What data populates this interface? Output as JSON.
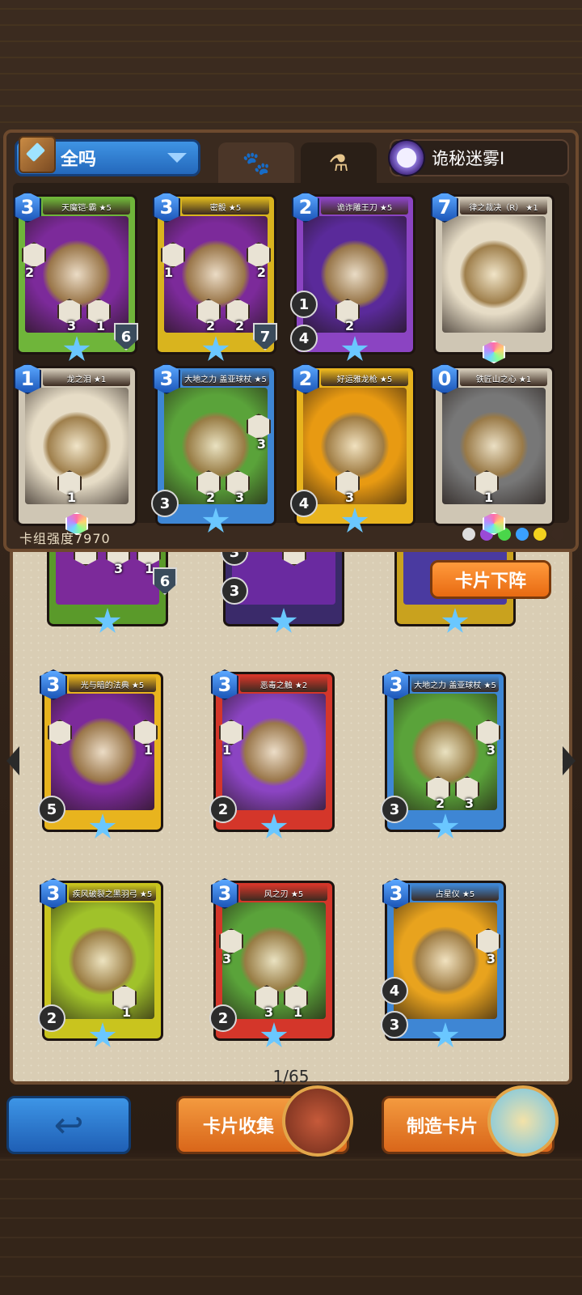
{
  "filter": {
    "label": "全吗"
  },
  "mist": {
    "label": "诡秘迷雾Ⅰ"
  },
  "deck_power": "卡组强度7970",
  "buttons": {
    "unequip": "卡片下阵",
    "collect": "卡片收集",
    "craft": "制造卡片"
  },
  "pager": "1/65",
  "deck_cards": [
    {
      "name": "天魔铠·霸 ★5",
      "cost": "3",
      "left": "2",
      "n1": "3",
      "n2": "1",
      "def": "6",
      "theme": "#6fb53a",
      "bg": "#7c2a9a"
    },
    {
      "name": "密骰 ★5",
      "cost": "3",
      "left": "1",
      "right": "2",
      "n1": "2",
      "n2": "2",
      "def": "7",
      "theme": "#d9b41e",
      "bg": "#7c2a9a"
    },
    {
      "name": "诡诈雕王刀 ★5",
      "cost": "2",
      "n1": "2",
      "c1": "1",
      "c2": "4",
      "theme": "#8b44c2",
      "bg": "#5a2a9a"
    },
    {
      "name": "律之裁决（R） ★1",
      "cost": "7",
      "theme": "#cfc6b4",
      "bg": "#e6dcc6"
    },
    {
      "name": "龙之泪 ★1",
      "cost": "1",
      "n1": "1",
      "theme": "#cfc6b4",
      "bg": "#e6dcc6"
    },
    {
      "name": "大地之力 盖亚球杖 ★5",
      "cost": "3",
      "right": "3",
      "n1": "2",
      "n2": "3",
      "c1": "3",
      "theme": "#3e86d4",
      "bg": "#5aa33a"
    },
    {
      "name": "好运雅龙枪 ★5",
      "cost": "2",
      "n1": "3",
      "c1": "4",
      "theme": "#e8b41e",
      "bg": "#e89a12"
    },
    {
      "name": "铁匠山之心 ★1",
      "cost": "0",
      "n1": "1",
      "theme": "#cfc6b4",
      "bg": "#777777"
    }
  ],
  "collection_cards": [
    {
      "name": "光与暗的法典 ★5",
      "cost": "3",
      "left": "",
      "right": "1",
      "c1": "5",
      "theme": "#e8b41e",
      "bg": "#7c2a9a"
    },
    {
      "name": "恶毒之触 ★2",
      "cost": "3",
      "left": "1",
      "c1": "2",
      "theme": "#d4362a",
      "bg": "#8b44c2"
    },
    {
      "name": "大地之力 盖亚球杖 ★5",
      "cost": "3",
      "right": "3",
      "n1": "2",
      "n2": "3",
      "c1": "3",
      "theme": "#3e86d4",
      "bg": "#5aa33a"
    },
    {
      "name": "疾风破裂之黑羽弓 ★5",
      "cost": "3",
      "n2": "1",
      "c1": "2",
      "theme": "#c9c41e",
      "bg": "#a0c22a"
    },
    {
      "name": "风之刃 ★5",
      "cost": "3",
      "left": "3",
      "n1": "3",
      "n2": "1",
      "c1": "2",
      "theme": "#d4362a",
      "bg": "#5aa33a"
    },
    {
      "name": "占星仪 ★5",
      "cost": "3",
      "right": "3",
      "c1": "4",
      "c2": "3",
      "theme": "#3e86d4",
      "bg": "#e8a31e"
    }
  ],
  "partial_cards": [
    {
      "n1": "3",
      "n2": "1",
      "def": "6"
    },
    {
      "c1": "3",
      "c2": "3"
    },
    {}
  ],
  "colors": {
    "blue": "#2a6fd0",
    "orange": "#e8781c",
    "parchment": "#d9cdb4"
  }
}
